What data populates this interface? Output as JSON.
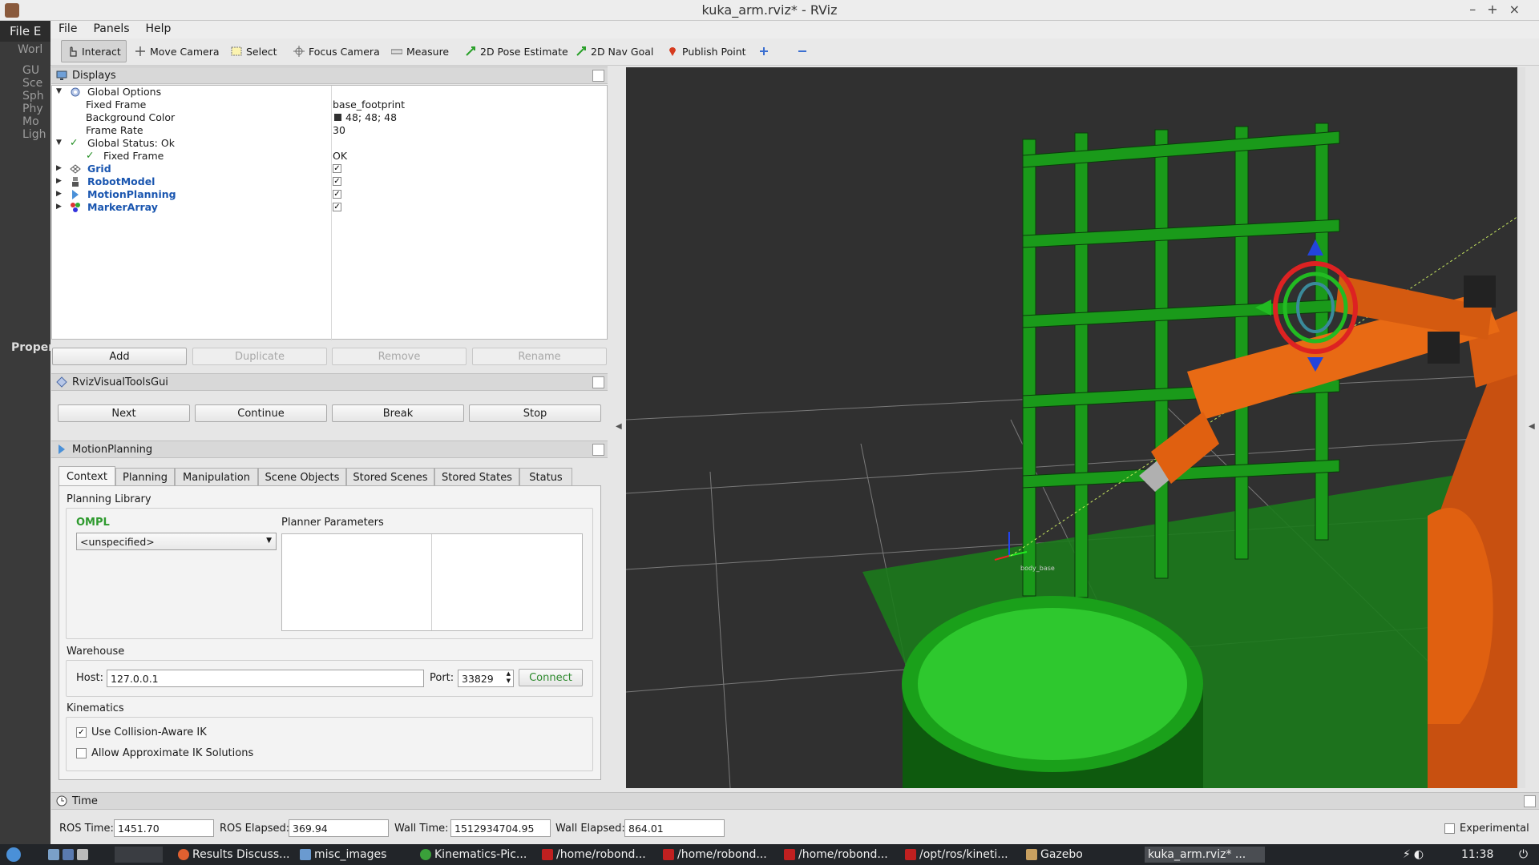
{
  "window": {
    "title": "kuka_arm.rviz* - RViz"
  },
  "background_app": {
    "menu_label": "File",
    "menu_label_2": "E",
    "tree_items": [
      "Worl",
      "GU",
      "Sce",
      "Sph",
      "Phy",
      "Mo",
      "Ligh"
    ],
    "properties_label": "Proper"
  },
  "menubar": {
    "file": "File",
    "panels": "Panels",
    "help": "Help"
  },
  "toolbar": {
    "interact": "Interact",
    "move_camera": "Move Camera",
    "select": "Select",
    "focus_camera": "Focus Camera",
    "measure": "Measure",
    "pose_estimate": "2D Pose Estimate",
    "nav_goal": "2D Nav Goal",
    "publish_point": "Publish Point"
  },
  "displays": {
    "title": "Displays",
    "rows": {
      "global_options": "Global Options",
      "fixed_frame": "Fixed Frame",
      "fixed_frame_value": "base_footprint",
      "background_color": "Background Color",
      "background_color_value": "48; 48; 48",
      "frame_rate": "Frame Rate",
      "frame_rate_value": "30",
      "global_status": "Global Status: Ok",
      "status_fixed_frame": "Fixed Frame",
      "status_fixed_frame_value": "OK",
      "grid": "Grid",
      "robot_model": "RobotModel",
      "motion_planning": "MotionPlanning",
      "marker_array": "MarkerArray"
    },
    "buttons": {
      "add": "Add",
      "duplicate": "Duplicate",
      "remove": "Remove",
      "rename": "Rename"
    }
  },
  "visual_tools": {
    "title": "RvizVisualToolsGui",
    "next": "Next",
    "continue": "Continue",
    "break": "Break",
    "stop": "Stop"
  },
  "motion_planning": {
    "title": "MotionPlanning",
    "tabs": [
      "Context",
      "Planning",
      "Manipulation",
      "Scene Objects",
      "Stored Scenes",
      "Stored States",
      "Status"
    ],
    "planning_library": "Planning Library",
    "library_name": "OMPL",
    "planner_select": "<unspecified>",
    "planner_parameters": "Planner Parameters",
    "warehouse": "Warehouse",
    "host_label": "Host:",
    "host_value": "127.0.0.1",
    "port_label": "Port:",
    "port_value": "33829",
    "connect": "Connect",
    "kinematics": "Kinematics",
    "collision_ik": "Use Collision-Aware IK",
    "approx_ik": "Allow Approximate IK Solutions"
  },
  "time": {
    "title": "Time",
    "ros_time_label": "ROS Time:",
    "ros_time": "1451.70",
    "ros_elapsed_label": "ROS Elapsed:",
    "ros_elapsed": "369.94",
    "wall_time_label": "Wall Time:",
    "wall_time": "1512934704.95",
    "wall_elapsed_label": "Wall Elapsed:",
    "wall_elapsed": "864.01",
    "experimental": "Experimental"
  },
  "viewport": {
    "frame_label": "body_base"
  },
  "taskbar": {
    "items": [
      "Results Discuss...",
      "misc_images",
      "Kinematics-Pic...",
      "/home/robond...",
      "/home/robond...",
      "/home/robond...",
      "/opt/ros/kineti...",
      "Gazebo",
      "kuka_arm.rviz* ..."
    ],
    "clock": "11:38"
  },
  "colors": {
    "viewport_bg": "#303030",
    "shelf": "#1e8a1e",
    "robot": "#e06010",
    "accent_blue": "#1a56b0"
  }
}
